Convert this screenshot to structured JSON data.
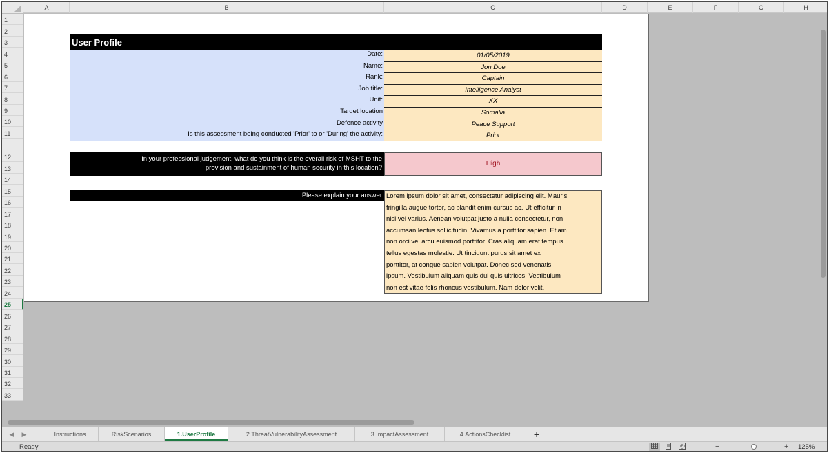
{
  "spreadsheet": {
    "columns": [
      "A",
      "B",
      "C",
      "D",
      "E",
      "F",
      "G",
      "H"
    ],
    "rows": [
      "1",
      "2",
      "3",
      "4",
      "5",
      "6",
      "7",
      "8",
      "9",
      "10",
      "11",
      "12",
      "13",
      "14",
      "15",
      "16",
      "17",
      "18",
      "19",
      "20",
      "21",
      "22",
      "23",
      "24",
      "25",
      "26",
      "27",
      "28",
      "29",
      "30",
      "31",
      "32",
      "33"
    ],
    "active_row": "25"
  },
  "profile": {
    "title": "User Profile",
    "fields": [
      {
        "label": "Date:",
        "value": "01/05/2019"
      },
      {
        "label": "Name:",
        "value": "Jon Doe"
      },
      {
        "label": "Rank:",
        "value": "Captain"
      },
      {
        "label": "Job title:",
        "value": "Intelligence Analyst"
      },
      {
        "label": "Unit:",
        "value": "XX"
      },
      {
        "label": "Target location",
        "value": "Somalia"
      },
      {
        "label": "Defence activity",
        "value": "Peace Support"
      },
      {
        "label": "Is this assessment being conducted 'Prior' to or 'During' the activity:",
        "value": "Prior"
      }
    ],
    "risk_question_line1": "In your professional judgement, what do you think is the overall risk of MSHT to the",
    "risk_question_line2": "provision and sustainment of human security in this location?",
    "risk_answer": "High",
    "explain_label": "Please explain your answer",
    "explain_lines": [
      "Lorem ipsum dolor sit amet, consectetur adipiscing elit. Mauris",
      "fringilla augue tortor, ac blandit enim cursus ac. Ut efficitur in",
      "nisi vel varius. Aenean volutpat justo a nulla consectetur, non",
      "accumsan lectus sollicitudin. Vivamus a porttitor sapien. Etiam",
      "non orci vel arcu euismod porttitor. Cras aliquam erat tempus",
      "tellus egestas molestie. Ut tincidunt purus sit amet ex",
      "porttitor, at congue sapien volutpat. Donec sed venenatis",
      "ipsum. Vestibulum aliquam quis dui quis ultrices. Vestibulum",
      "non est vitae felis rhoncus vestibulum. Nam dolor velit,"
    ]
  },
  "tabs": {
    "prev": "◀",
    "next": "▶",
    "items": [
      "Instructions",
      "RiskScenarios",
      "1.UserProfile",
      "2.ThreatVulnerabilityAssessment",
      "3.ImpactAssessment",
      "4.ActionsChecklist"
    ],
    "active": "1.UserProfile",
    "add": "+"
  },
  "status": {
    "text": "Ready",
    "zoom_minus": "−",
    "zoom_plus": "+",
    "zoom": "125%",
    "zoom_fraction": 0.5
  },
  "icons": {
    "normal_view": "grid-icon",
    "page_layout": "page-layout-icon",
    "page_break": "page-break-icon"
  }
}
